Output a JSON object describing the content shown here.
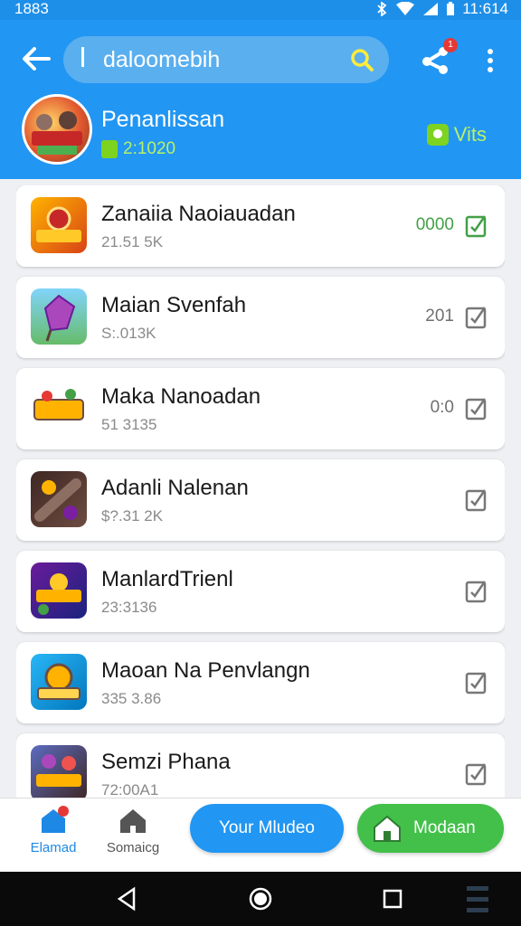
{
  "status_bar": {
    "time": "1883",
    "clock": "11:614"
  },
  "search": {
    "query": "daloomebih"
  },
  "notifications": {
    "badge": "1"
  },
  "profile": {
    "name": "Penanlissan",
    "sub": "2:1020",
    "right_label": "Vits"
  },
  "items": [
    {
      "title": "Zanaiia Naoiauadan",
      "sub": "21.51 5K",
      "count": "0000",
      "count_color": "#43a047"
    },
    {
      "title": "Maian Svenfah",
      "sub": "S:.013K",
      "count": "201"
    },
    {
      "title": "Maka Nanoadan",
      "sub": "51 3135",
      "count": "0:0"
    },
    {
      "title": "Adanli Nalenan",
      "sub": "$?.31 2K",
      "count": ""
    },
    {
      "title": "ManlardTrienl",
      "sub": "23:3136",
      "count": ""
    },
    {
      "title": "Maoan Na Penvlangn",
      "sub": "335 3.86",
      "count": ""
    },
    {
      "title": "Semzi Phana",
      "sub": "72:00A1",
      "count": ""
    }
  ],
  "bottom_bar": {
    "home_label": "Elamad",
    "search_label": "Somaicg",
    "primary_button": "Your Mludeo",
    "green_button": "Modaan"
  },
  "colors": {
    "header": "#2196f3",
    "accent_green": "#43c04a",
    "primary": "#2196f3"
  }
}
